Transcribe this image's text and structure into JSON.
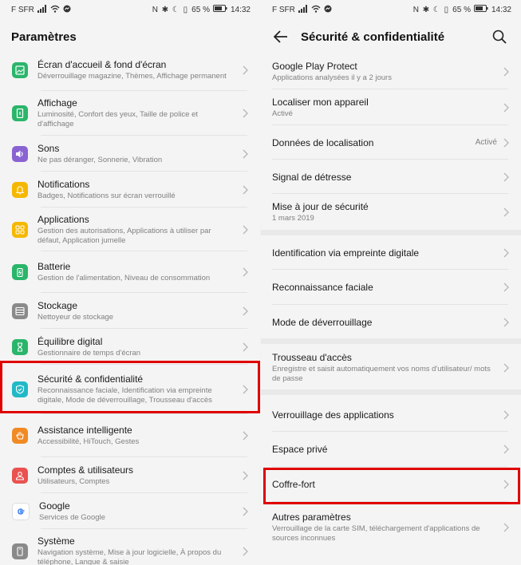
{
  "status_bar": {
    "carrier": "F SFR",
    "right_icons": "N ✱ ☾ ▯",
    "battery": "65 %",
    "time": "14:32"
  },
  "left_panel": {
    "title": "Paramètres",
    "items": [
      {
        "title": "Écran d'accueil & fond d'écran",
        "subtitle": "Déverrouillage magazine, Thèmes, Affichage permanent",
        "icon": "wallpaper-icon",
        "color": "#2bb56b"
      },
      {
        "title": "Affichage",
        "subtitle": "Luminosité, Confort des yeux, Taille de police et d'affichage",
        "icon": "display-icon",
        "color": "#2bb56b"
      },
      {
        "title": "Sons",
        "subtitle": "Ne pas déranger, Sonnerie, Vibration",
        "icon": "sound-icon",
        "color": "#8a63d2"
      },
      {
        "title": "Notifications",
        "subtitle": "Badges, Notifications sur écran verrouillé",
        "icon": "bell-icon",
        "color": "#f5b800"
      },
      {
        "title": "Applications",
        "subtitle": "Gestion des autorisations, Applications à utiliser par défaut, Application jumelle",
        "icon": "apps-icon",
        "color": "#f5b800"
      },
      {
        "title": "Batterie",
        "subtitle": "Gestion de l'alimentation, Niveau de consommation",
        "icon": "battery-icon",
        "color": "#2bb56b"
      },
      {
        "title": "Stockage",
        "subtitle": "Nettoyeur de stockage",
        "icon": "storage-icon",
        "color": "#8a8a8a"
      },
      {
        "title": "Équilibre digital",
        "subtitle": "Gestionnaire de temps d'écran",
        "icon": "hourglass-icon",
        "color": "#2bb56b"
      },
      {
        "title": "Sécurité & confidentialité",
        "subtitle": "Reconnaissance faciale, Identification via empreinte digitale, Mode de déverrouillage, Trousseau d'accès",
        "icon": "shield-icon",
        "color": "#22b9c7"
      },
      {
        "title": "Assistance intelligente",
        "subtitle": "Accessibilité, HiTouch, Gestes",
        "icon": "hand-icon",
        "color": "#f08a24"
      },
      {
        "title": "Comptes & utilisateurs",
        "subtitle": "Utilisateurs, Comptes",
        "icon": "user-icon",
        "color": "#e9524f"
      },
      {
        "title": "Google",
        "subtitle": "Services de Google",
        "icon": "google-icon",
        "color": "#ffffff"
      },
      {
        "title": "Système",
        "subtitle": "Navigation système, Mise à jour logicielle, À propos du téléphone, Langue & saisie",
        "icon": "system-icon",
        "color": "#8a8a8a"
      }
    ]
  },
  "right_panel": {
    "title": "Sécurité & confidentialité",
    "items": [
      {
        "title": "Google Play Protect",
        "subtitle": "Applications analysées il y a 2 jours"
      },
      {
        "title": "Localiser mon appareil",
        "subtitle": "Activé"
      },
      {
        "title": "Données de localisation",
        "value": "Activé"
      },
      {
        "title": "Signal de détresse"
      },
      {
        "title": "Mise à jour de sécurité",
        "subtitle": "1 mars 2019"
      },
      {
        "title": "Identification via empreinte digitale"
      },
      {
        "title": "Reconnaissance faciale"
      },
      {
        "title": "Mode de déverrouillage"
      },
      {
        "title": "Trousseau d'accès",
        "subtitle": "Enregistre et saisit automatiquement vos noms d'utilisateur/ mots de passe"
      },
      {
        "title": "Verrouillage des applications"
      },
      {
        "title": "Espace privé"
      },
      {
        "title": "Coffre-fort"
      },
      {
        "title": "Autres paramètres",
        "subtitle": "Verrouillage de la carte SIM, téléchargement d'applications de sources inconnues"
      }
    ]
  },
  "accent": {
    "highlight": "#e00000"
  }
}
